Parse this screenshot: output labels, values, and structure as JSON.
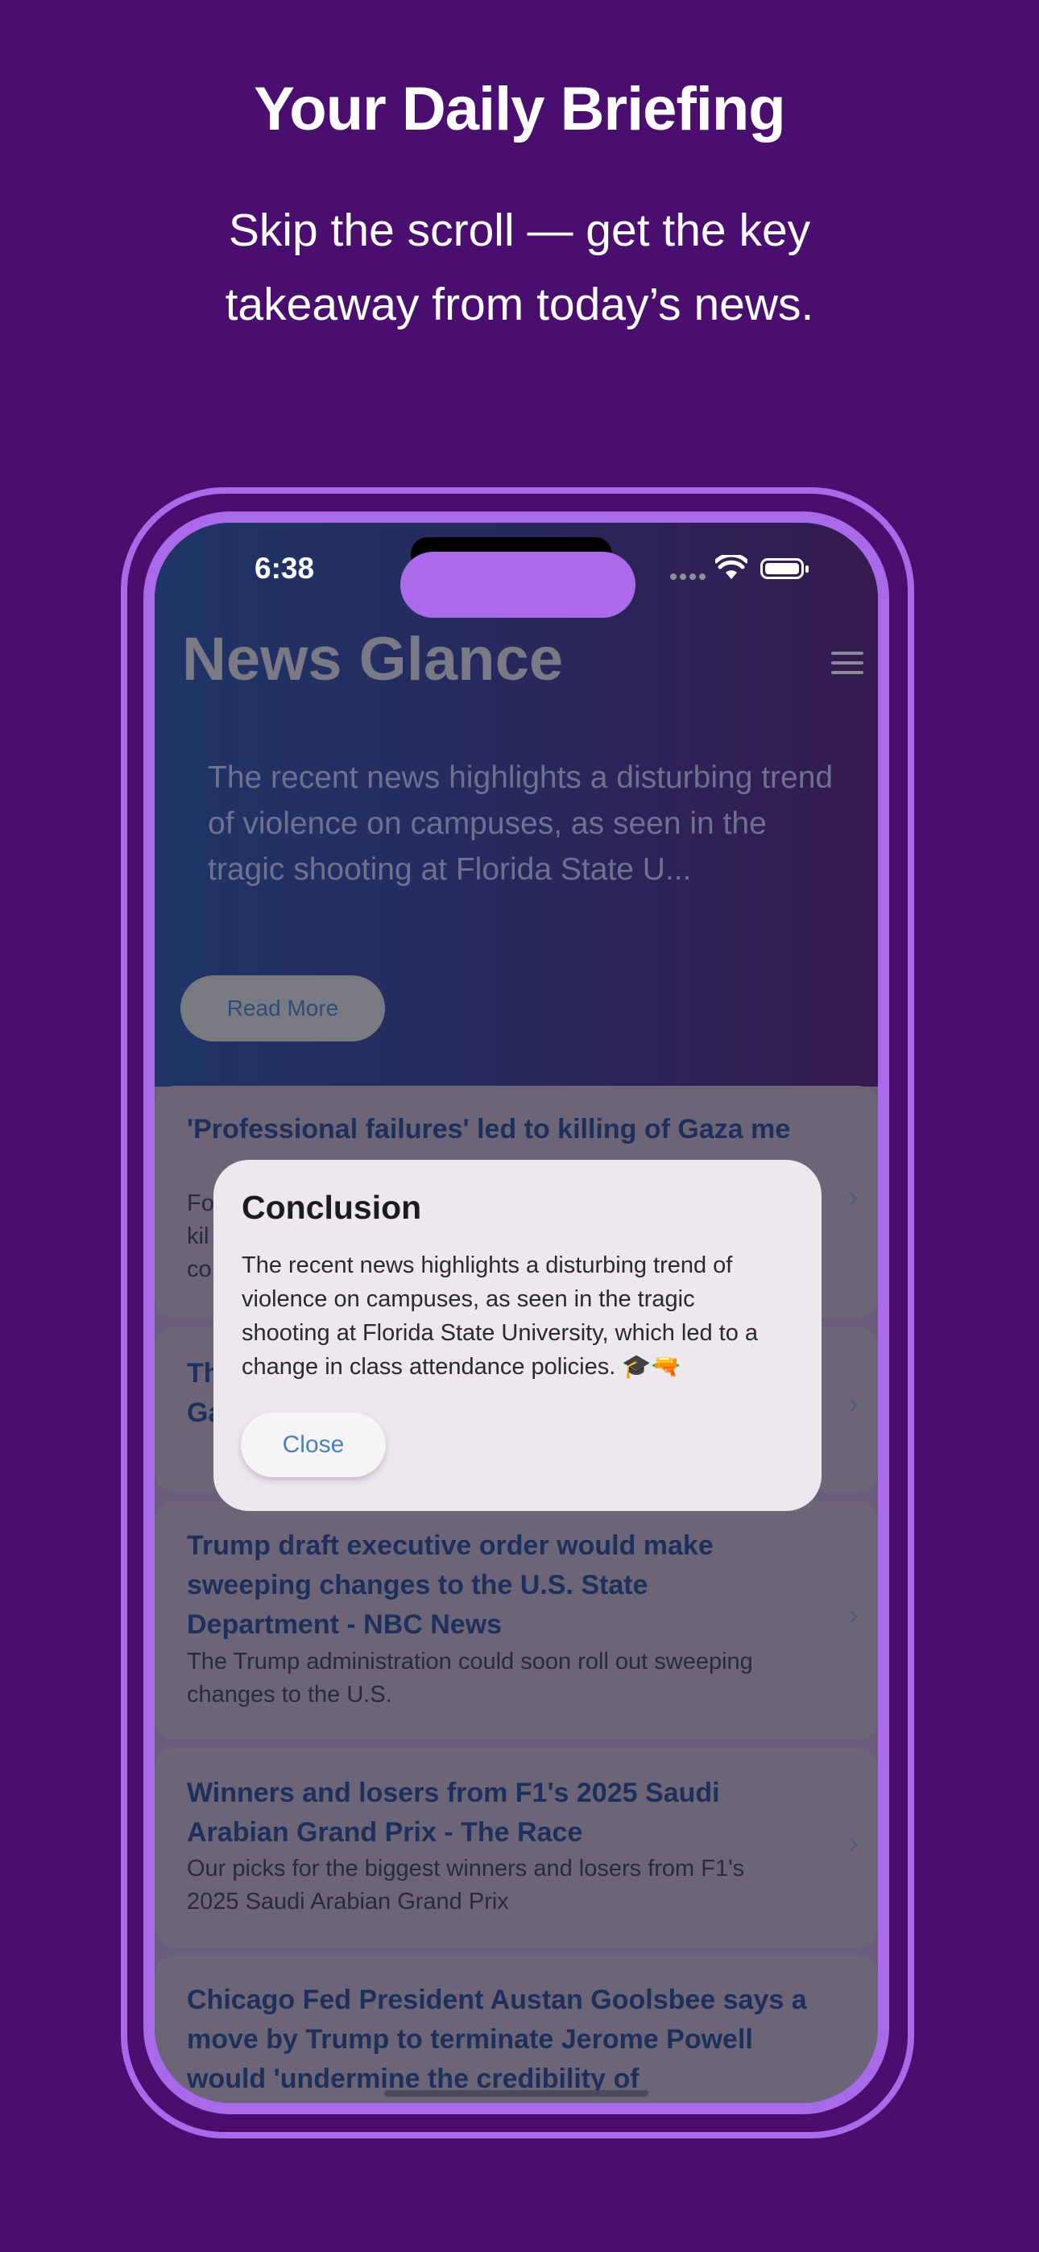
{
  "hero": {
    "title": "Your Daily Briefing",
    "subtitle_line1": "Skip the scroll — get the key",
    "subtitle_line2": "takeaway from today’s news."
  },
  "status_bar": {
    "time": "6:38"
  },
  "app": {
    "title": "News Glance",
    "summary": "The recent news highlights a disturbing trend of violence on campuses, as seen in the tragic shooting at Florida State U...",
    "read_more_label": "Read More"
  },
  "articles": [
    {
      "title": "'Professional failures' led to killing of Gaza me",
      "desc_line1": "Fo",
      "desc_line2": "kil",
      "desc_line3": "co"
    },
    {
      "title_line1": "Th",
      "title_line2": "Ga"
    },
    {
      "title": "Trump draft executive order would make sweeping changes to the U.S. State Department - NBC News",
      "desc": "The Trump administration could soon roll out sweeping changes to the U.S."
    },
    {
      "title": "Winners and losers from F1's 2025 Saudi Arabian Grand Prix - The Race",
      "desc": "Our picks for the biggest winners and losers from F1's 2025 Saudi Arabian Grand Prix"
    },
    {
      "title": "Chicago Fed President Austan Goolsbee says a move by Trump to terminate Jerome Powell would 'undermine the credibility of"
    }
  ],
  "dialog": {
    "title": "Conclusion",
    "body": "The recent news highlights a disturbing trend of violence on campuses, as seen in the tragic shooting at Florida State University, which led to a change in class attendance policies. 🎓🔫",
    "close_label": "Close"
  }
}
